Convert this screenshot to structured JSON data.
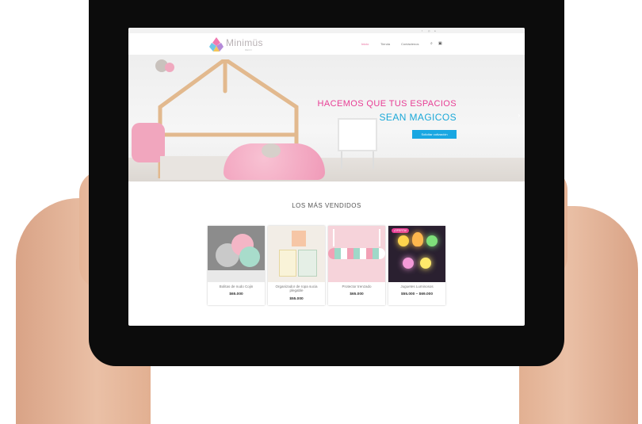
{
  "site": {
    "logo_text": "Minimüs",
    "logo_sub": "DECO"
  },
  "nav": {
    "items": [
      "Inicio",
      "Tienda",
      "Contáctenos"
    ],
    "active_index": 0
  },
  "hero": {
    "title_line1": "HACEMOS QUE TUS ESPACIOS",
    "title_line2": "SEAN MAGICOS",
    "button_label": "Solicitar cotización"
  },
  "section": {
    "title": "LOS MÁS VENDIDOS"
  },
  "products": [
    {
      "name": "Bolitas de nudo Cojin",
      "price": "$65.000"
    },
    {
      "name": "Organizador de ropa sucia plegable",
      "price": "$55.000"
    },
    {
      "name": "Protector trenzado",
      "price": "$65.000"
    },
    {
      "name": "Juguetes Luminosos",
      "price": "$55.000 – $69.000",
      "badge": "¡OFERTA!"
    }
  ],
  "colors": {
    "accent_pink": "#e83e95",
    "accent_blue": "#1aa8d8",
    "button_blue": "#19a7e2",
    "tablet_frame": "#0c0c0c"
  },
  "icons": [
    "search-icon",
    "cart-icon",
    "facebook-icon",
    "instagram-icon",
    "arrow-right-icon"
  ]
}
